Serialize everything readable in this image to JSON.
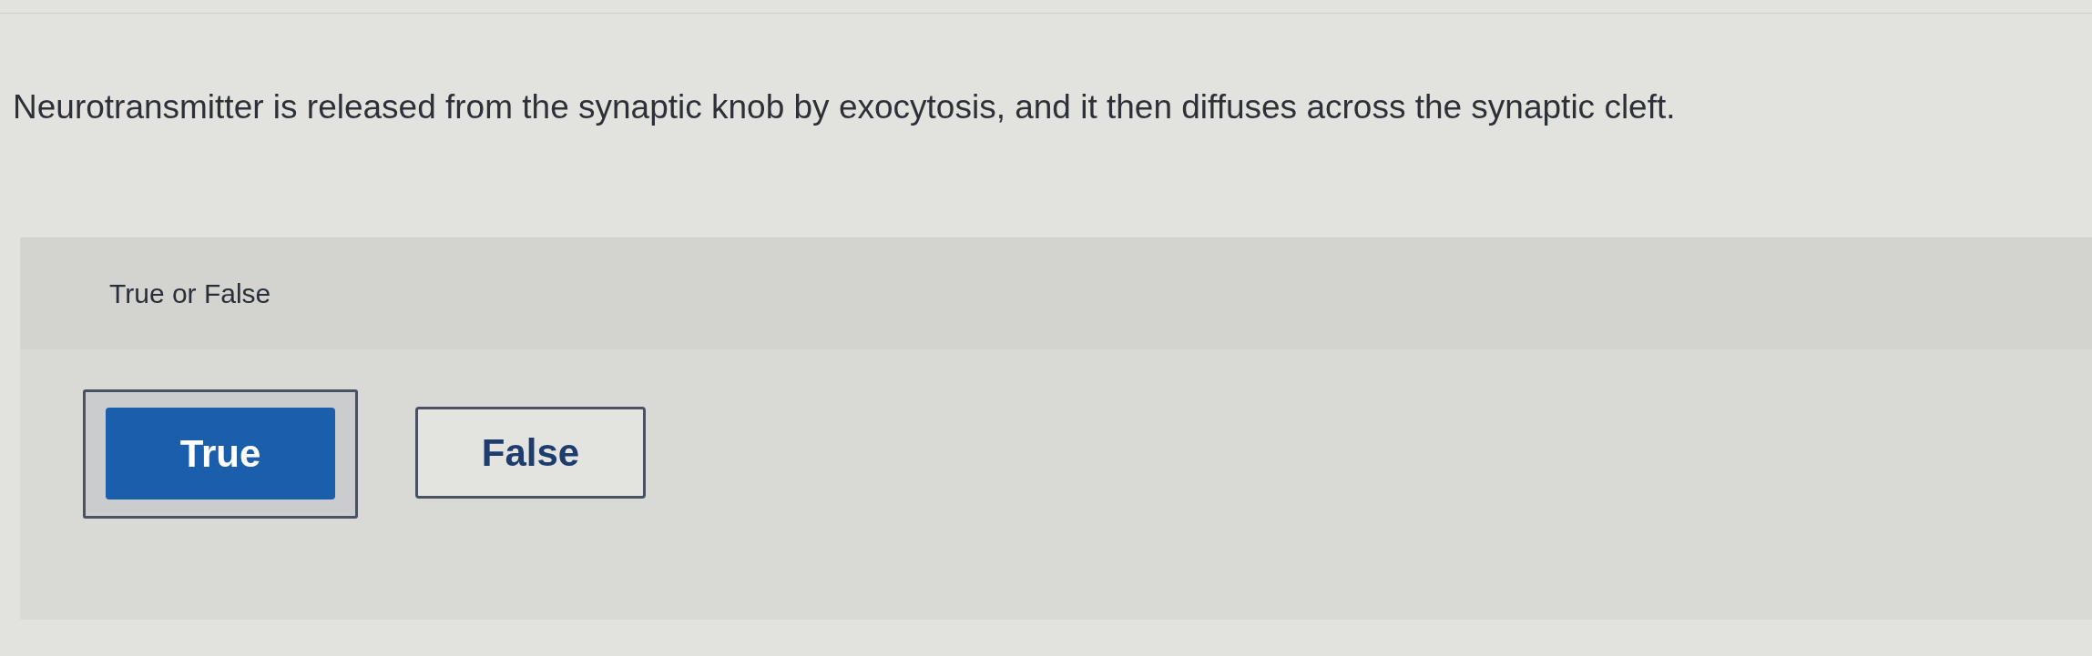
{
  "question": {
    "text": "Neurotransmitter is released from the synaptic knob by exocytosis, and it then diffuses across the synaptic cleft."
  },
  "answer_card": {
    "prompt": "True or False",
    "options": [
      {
        "label": "True",
        "selected": true
      },
      {
        "label": "False",
        "selected": false
      }
    ]
  }
}
